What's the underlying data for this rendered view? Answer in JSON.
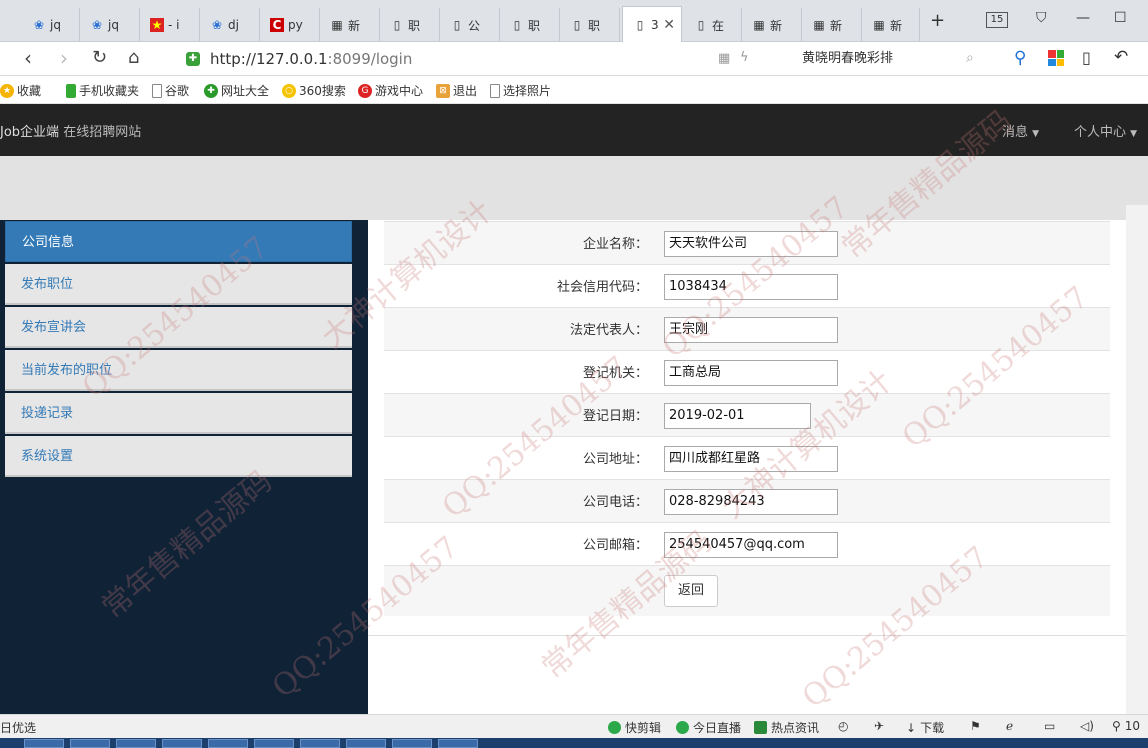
{
  "browser": {
    "tabs": [
      {
        "label": "jq",
        "icon": "paw-icon"
      },
      {
        "label": "jq",
        "icon": "paw-icon"
      },
      {
        "label": "- i",
        "icon": "flag-icon"
      },
      {
        "label": "dj",
        "icon": "paw-icon"
      },
      {
        "label": "py",
        "icon": "c-icon"
      },
      {
        "label": "新",
        "icon": "grid-icon"
      },
      {
        "label": "职",
        "icon": "page-icon"
      },
      {
        "label": "公",
        "icon": "page-icon"
      },
      {
        "label": "职",
        "icon": "page-icon"
      },
      {
        "label": "职",
        "icon": "page-icon"
      },
      {
        "label": "3",
        "icon": "page-icon",
        "active": true
      },
      {
        "label": "在",
        "icon": "page-icon"
      },
      {
        "label": "新",
        "icon": "grid-icon"
      },
      {
        "label": "新",
        "icon": "grid-icon"
      },
      {
        "label": "新",
        "icon": "grid-icon"
      }
    ],
    "tab_count": "15",
    "new_tab": "+",
    "url_host": "http://127.0.0.1",
    "url_rest": ":8099/login",
    "search_text": "黄晓明春晚彩排",
    "bookmarks": [
      "收藏",
      "手机收藏夹",
      "谷歌",
      "网址大全",
      "360搜索",
      "游戏中心",
      "退出",
      "选择照片"
    ]
  },
  "site": {
    "brand_prefix": "Job企业端",
    "brand_suffix": "在线招聘网站",
    "nav_messages": "消息",
    "nav_profile": "个人中心"
  },
  "sidebar": {
    "items": [
      {
        "label": "公司信息",
        "active": true
      },
      {
        "label": "发布职位"
      },
      {
        "label": "发布宣讲会"
      },
      {
        "label": "当前发布的职位"
      },
      {
        "label": "投递记录"
      },
      {
        "label": "系统设置"
      }
    ]
  },
  "form": {
    "fields": [
      {
        "label": "企业名称：",
        "value": "天天软件公司"
      },
      {
        "label": "社会信用代码：",
        "value": "1038434"
      },
      {
        "label": "法定代表人：",
        "value": "王宗刚"
      },
      {
        "label": "登记机关：",
        "value": "工商总局"
      },
      {
        "label": "登记日期：",
        "value": "2019-02-01"
      },
      {
        "label": "公司地址：",
        "value": "四川成都红星路"
      },
      {
        "label": "公司电话：",
        "value": "028-82984243"
      },
      {
        "label": "公司邮箱：",
        "value": "254540457@qq.com"
      }
    ],
    "back_label": "返回"
  },
  "statusbar": {
    "left_text": "日优选",
    "items": [
      "快剪辑",
      "今日直播",
      "热点资讯",
      "下载"
    ],
    "zoom": "10"
  },
  "watermark": [
    "QQ:254540457",
    "大神计算机设计",
    "常年售精品源码"
  ]
}
